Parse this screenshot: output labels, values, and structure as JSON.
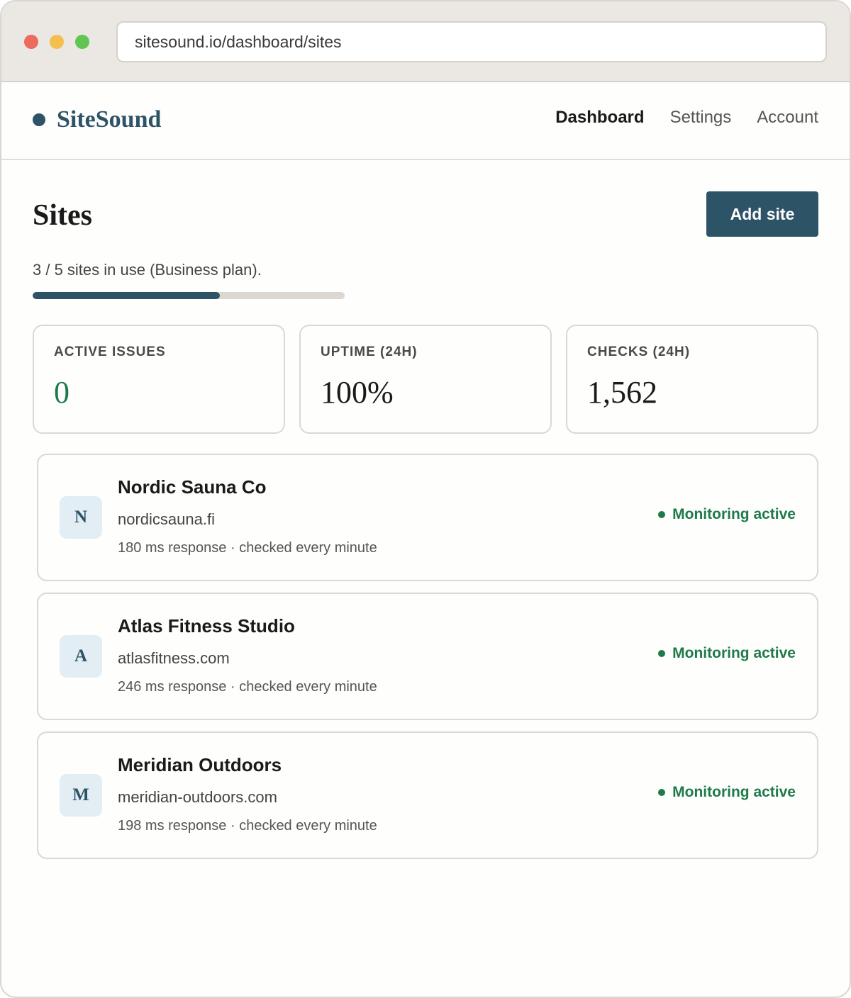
{
  "browser": {
    "url": "sitesound.io/dashboard/sites"
  },
  "nav": {
    "brand": "SiteSound",
    "links": [
      {
        "label": "Dashboard",
        "active": true
      },
      {
        "label": "Settings",
        "active": false
      },
      {
        "label": "Account",
        "active": false
      }
    ]
  },
  "page": {
    "title": "Sites",
    "add_button": "Add site",
    "usage_text": "3 / 5 sites in use (Business plan).",
    "usage_fraction": 0.6
  },
  "stats": [
    {
      "label": "ACTIVE ISSUES",
      "value": "0"
    },
    {
      "label": "UPTIME (24H)",
      "value": "100%"
    },
    {
      "label": "CHECKS (24H)",
      "value": "1,562"
    }
  ],
  "sites": [
    {
      "initial": "N",
      "name": "Nordic Sauna Co",
      "domain": "nordicsauna.fi",
      "meta": "180 ms response · checked every minute",
      "status": "Monitoring active"
    },
    {
      "initial": "A",
      "name": "Atlas Fitness Studio",
      "domain": "atlasfitness.com",
      "meta": "246 ms response · checked every minute",
      "status": "Monitoring active"
    },
    {
      "initial": "M",
      "name": "Meridian Outdoors",
      "domain": "meridian-outdoors.com",
      "meta": "198 ms response · checked every minute",
      "status": "Monitoring active"
    }
  ],
  "colors": {
    "brand": "#2d5366",
    "success": "#1f7a4a"
  }
}
